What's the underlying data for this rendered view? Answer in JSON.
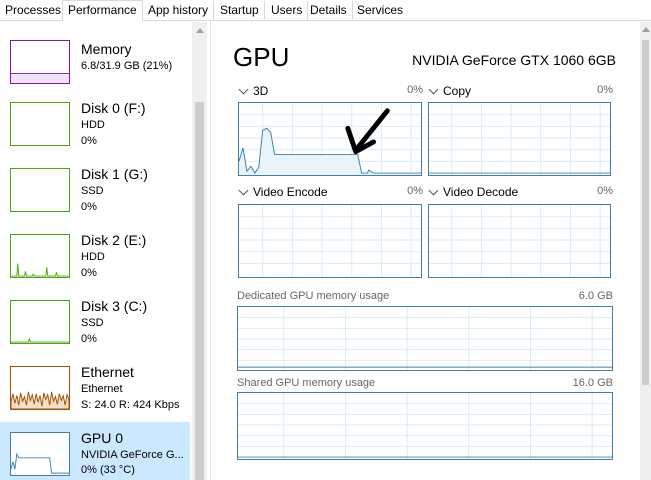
{
  "tabs": [
    "Processes",
    "Performance",
    "App history",
    "Startup",
    "Users",
    "Details",
    "Services"
  ],
  "active_tab": "Performance",
  "sidebar": {
    "items": [
      {
        "name": "Memory",
        "line1": "6.8/31.9 GB (21%)",
        "line2": "",
        "color": "#8b12ae"
      },
      {
        "name": "Disk 0 (F:)",
        "line1": "HDD",
        "line2": "0%",
        "color": "#4da60c"
      },
      {
        "name": "Disk 1 (G:)",
        "line1": "SSD",
        "line2": "0%",
        "color": "#4da60c"
      },
      {
        "name": "Disk 2 (E:)",
        "line1": "HDD",
        "line2": "0%",
        "color": "#4da60c"
      },
      {
        "name": "Disk 3 (C:)",
        "line1": "SSD",
        "line2": "0%",
        "color": "#4da60c"
      },
      {
        "name": "Ethernet",
        "line1": "Ethernet",
        "line2": "S: 24.0  R: 424 Kbps",
        "color": "#a74f01"
      },
      {
        "name": "GPU 0",
        "line1": "NVIDIA GeForce G...",
        "line2": "0% (33 °C)",
        "color": "#3c7fb1"
      }
    ]
  },
  "gpu": {
    "title": "GPU",
    "device": "NVIDIA GeForce GTX 1060 6GB",
    "engines": [
      {
        "label": "3D",
        "percent": "0%"
      },
      {
        "label": "Copy",
        "percent": "0%"
      },
      {
        "label": "Video Encode",
        "percent": "0%"
      },
      {
        "label": "Video Decode",
        "percent": "0%"
      }
    ],
    "dedicated": {
      "label": "Dedicated GPU memory usage",
      "value": "6.0 GB"
    },
    "shared": {
      "label": "Shared GPU memory usage",
      "value": "16.0 GB"
    }
  },
  "colors": {
    "gpu_accent": "#3c7fb1",
    "grid": "#d9eaf7",
    "selected_bg": "#cce8ff",
    "annotation": "#000000"
  }
}
